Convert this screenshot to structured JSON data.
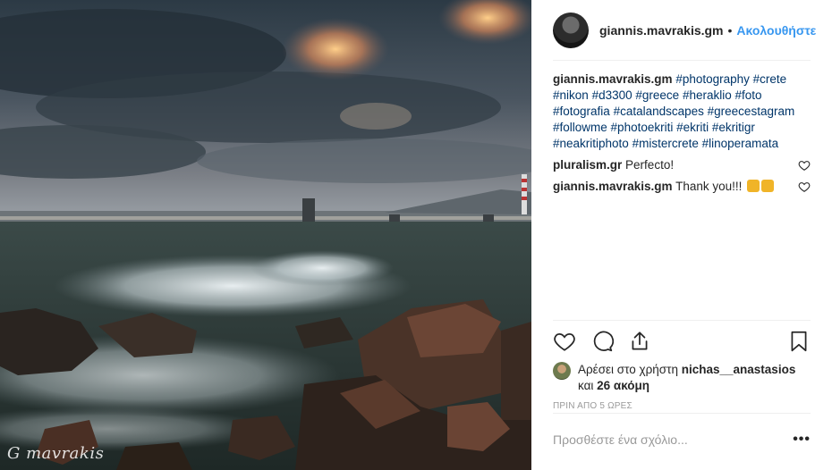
{
  "post": {
    "watermark": "G mavrakis",
    "author": "giannis.mavrakis.gm",
    "separator": "•",
    "follow_label": "Ακολουθήστε"
  },
  "caption": {
    "username": "giannis.mavrakis.gm",
    "hashtags": [
      "#photography",
      "#crete",
      "#nikon",
      "#d3300",
      "#greece",
      "#heraklio",
      "#foto",
      "#fotografia",
      "#catalandscapes",
      "#greecestagram",
      "#followme",
      "#photoekriti",
      "#ekriti",
      "#ekritigr",
      "#neakritiphoto",
      "#mistercrete",
      "#linoperamata"
    ]
  },
  "comments": [
    {
      "username": "pluralism.gr",
      "text": "Perfecto!"
    },
    {
      "username": "giannis.mavrakis.gm",
      "text": "Thank you!!!"
    }
  ],
  "likes": {
    "prefix": "Αρέσει στο χρήστη",
    "username": "nichas__anastasios",
    "and": "και",
    "others": "26 ακόμη"
  },
  "timestamp": "ΠΡΙΝ ΑΠΟ 5 ΩΡΕΣ",
  "add_comment": {
    "placeholder": "Προσθέστε ένα σχόλιο...",
    "more": "•••"
  },
  "icons": {
    "like": "heart-icon",
    "comment": "comment-icon",
    "share": "share-icon",
    "save": "bookmark-icon",
    "comment_like": "heart-icon"
  },
  "colors": {
    "link": "#3897f0",
    "hashtag": "#003569",
    "muted": "#999999",
    "text": "#262626",
    "border": "#efefef"
  }
}
